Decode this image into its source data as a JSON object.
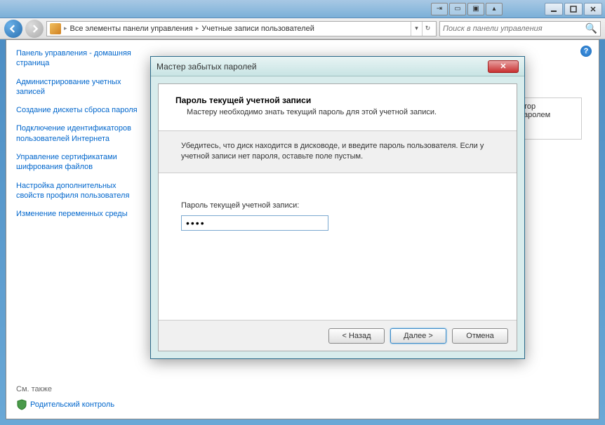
{
  "titlebar": {
    "min_tip": "Свернуть",
    "max_tip": "Развернуть",
    "close_tip": "Закрыть"
  },
  "nav": {
    "breadcrumb_icon": "control-panel-icon",
    "crumb1": "Все элементы панели управления",
    "crumb2": "Учетные записи пользователей",
    "search_placeholder": "Поиск в панели управления"
  },
  "sidebar": {
    "home": "Панель управления - домашняя страница",
    "links": [
      "Администрирование учетных записей",
      "Создание дискеты сброса пароля",
      "Подключение идентификаторов пользователей Интернета",
      "Управление сертификатами шифрования файлов",
      "Настройка дополнительных свойств профиля пользователя",
      "Изменение переменных среды"
    ],
    "footer_title": "См. также",
    "footer_link": "Родительский контроль"
  },
  "main_hint": {
    "line1": "тор",
    "line2": "аролем"
  },
  "dialog": {
    "title": "Мастер забытых паролей",
    "heading": "Пароль текущей учетной записи",
    "subheading": "Мастеру необходимо знать текущий пароль для этой учетной записи.",
    "instruction": "Убедитесь, что диск находится в дисководе, и введите пароль пользователя. Если у учетной записи нет пароля, оставьте поле пустым.",
    "field_label": "Пароль текущей учетной записи:",
    "password_value": "••••",
    "btn_back": "< Назад",
    "btn_next": "Далее >",
    "btn_cancel": "Отмена"
  }
}
